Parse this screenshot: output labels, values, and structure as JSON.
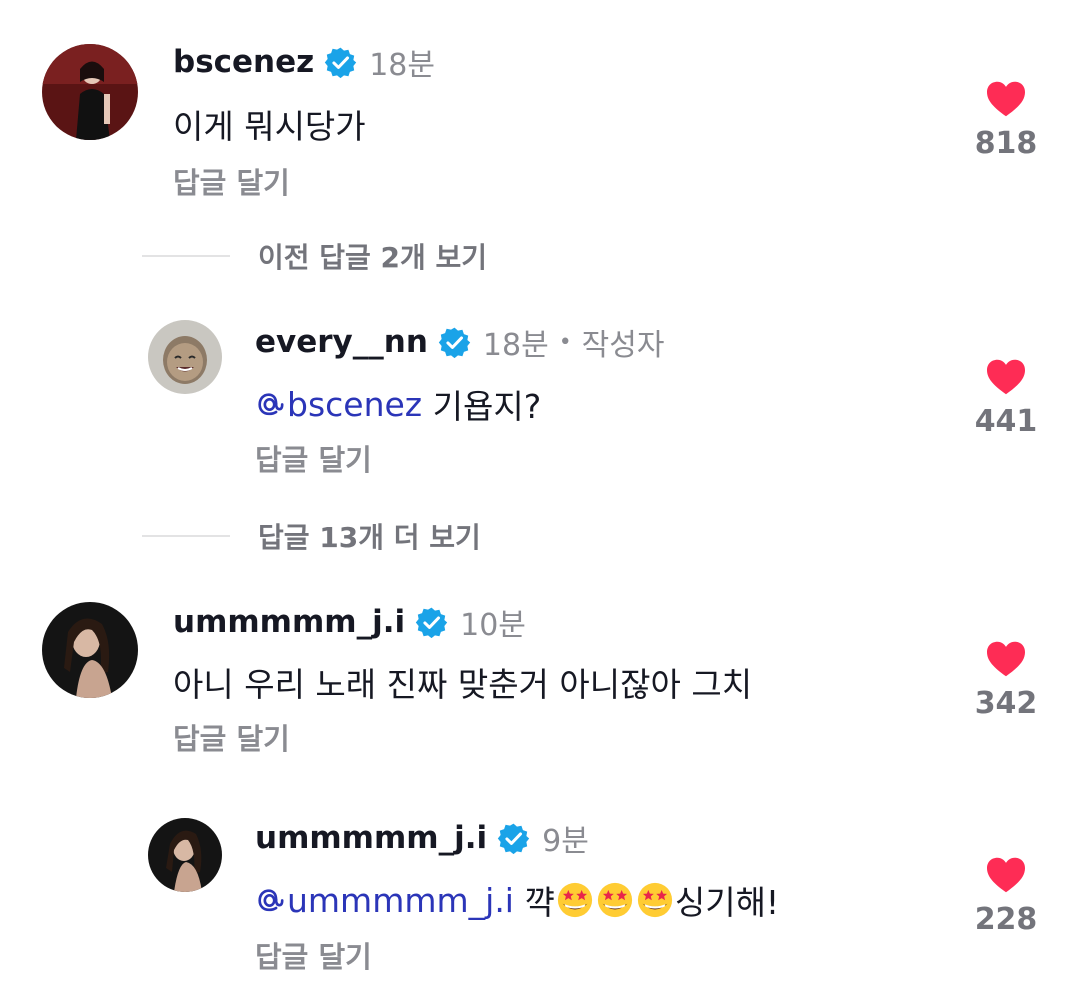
{
  "comments": [
    {
      "username": "bscenez",
      "time": "18분",
      "text": "이게 뭐시당가",
      "reply_label": "답글 달기",
      "likes": "818",
      "verified": true
    },
    {
      "username": "every__nn",
      "time": "18분",
      "author_badge": "작성자",
      "mention": "bscenez",
      "text": " 기욥지?",
      "reply_label": "답글 달기",
      "likes": "441",
      "verified": true
    },
    {
      "username": "ummmmm_j.i",
      "time": "10분",
      "text": "아니 우리 노래 진짜 맞춘거 아니잖아 그치",
      "reply_label": "답글 달기",
      "likes": "342",
      "verified": true
    },
    {
      "username": "ummmmm_j.i",
      "time": "9분",
      "mention": "ummmmm_j.i",
      "text_before": " 꺅",
      "text_after": "싱기해!",
      "emoji": "star-struck-emoji",
      "reply_label": "답글 달기",
      "likes": "228",
      "verified": true
    }
  ],
  "view_prev_replies": "이전 답글 2개 보기",
  "view_more_replies": "답글 13개 더 보기",
  "colors": {
    "heart": "#fe2c55",
    "verified": "#20d5ec",
    "mention": "#2b35b8",
    "muted": "#8a8b91"
  }
}
